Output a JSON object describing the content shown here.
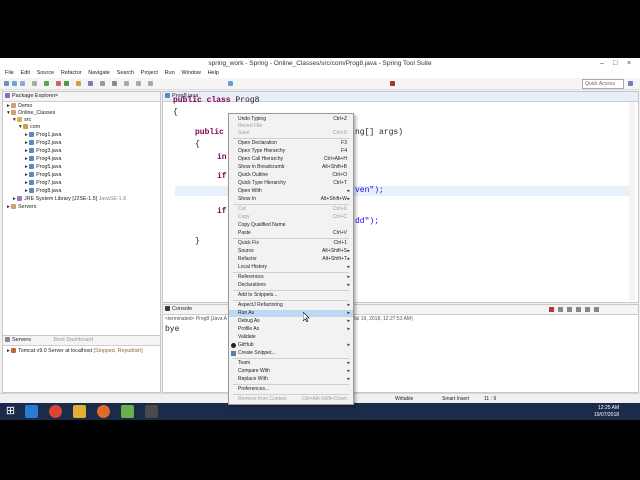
{
  "window": {
    "title": "spring_work - Spring - Online_Classes/src/com/Prog8.java - Spring Tool Suite"
  },
  "menubar": [
    "File",
    "Edit",
    "Source",
    "Refactor",
    "Navigate",
    "Search",
    "Project",
    "Run",
    "Window",
    "Help"
  ],
  "quick_access": {
    "placeholder": "Quick Access"
  },
  "package_explorer": {
    "title": "Package Explorer",
    "items": [
      "Demo",
      "Online_Classes",
      "src",
      "com",
      "Prog1.java",
      "Prog2.java",
      "Prog3.java",
      "Prog4.java",
      "Prog5.java",
      "Prog6.java",
      "Prog7.java",
      "Prog8.java",
      "JRE System Library [J2SE-1.5]",
      "JavaSE-1.8",
      "Servers"
    ]
  },
  "servers_panel": {
    "tab_servers": "Servers",
    "tab_boot": "Boot Dashboard",
    "item": "Tomcat v9.0 Server at localhost",
    "item_status": "[Stopped, Republish]"
  },
  "editor": {
    "tab": "Prog8.java",
    "lines": {
      "l1_kw": "public class",
      "l1_rest": " Prog8",
      "l2": "{",
      "l3_kw": "public",
      "l3_right": "ng[] args)",
      "l4": "{",
      "l5": "in",
      "l6": "if",
      "l6_right": "ven\");",
      "l7": "if",
      "l7_right": "dd\");",
      "l8": "}"
    }
  },
  "console": {
    "title": "Console",
    "terminated": "<terminated> Prog8 [Java A",
    "date": "Jul 19, 2018, 12:27:53 AM)",
    "output": "bye"
  },
  "status": {
    "writable": "Writable",
    "insert": "Smart Insert",
    "position": "11 : 9"
  },
  "taskbar": {
    "time": "12:25 AM",
    "date": "19/07/2018"
  },
  "context_menu": {
    "items": [
      {
        "label": "Undo Typing",
        "shortcut": "Ctrl+Z"
      },
      {
        "label": "Revert File",
        "shortcut": "",
        "disabled": true
      },
      {
        "label": "Save",
        "shortcut": "Ctrl+S",
        "disabled": true
      },
      {
        "label": "Open Declaration",
        "shortcut": "F3"
      },
      {
        "label": "Open Type Hierarchy",
        "shortcut": "F4"
      },
      {
        "label": "Open Call Hierarchy",
        "shortcut": "Ctrl+Alt+H"
      },
      {
        "label": "Show in Breadcrumb",
        "shortcut": "Alt+Shift+B"
      },
      {
        "label": "Quick Outline",
        "shortcut": "Ctrl+O"
      },
      {
        "label": "Quick Type Hierarchy",
        "shortcut": "Ctrl+T"
      },
      {
        "label": "Open With",
        "shortcut": ""
      },
      {
        "label": "Show In",
        "shortcut": "Alt+Shift+W"
      },
      {
        "label": "Cut",
        "shortcut": "Ctrl+X",
        "disabled": true
      },
      {
        "label": "Copy",
        "shortcut": "Ctrl+C",
        "disabled": true
      },
      {
        "label": "Copy Qualified Name",
        "shortcut": ""
      },
      {
        "label": "Paste",
        "shortcut": "Ctrl+V"
      },
      {
        "label": "Quick Fix",
        "shortcut": "Ctrl+1"
      },
      {
        "label": "Source",
        "shortcut": "Alt+Shift+S"
      },
      {
        "label": "Refactor",
        "shortcut": "Alt+Shift+T"
      },
      {
        "label": "Local History",
        "shortcut": ""
      },
      {
        "label": "References",
        "shortcut": ""
      },
      {
        "label": "Declarations",
        "shortcut": ""
      },
      {
        "label": "Add to Snippets...",
        "shortcut": ""
      },
      {
        "label": "AspectJ Refactoring",
        "shortcut": ""
      },
      {
        "label": "Run As",
        "shortcut": ""
      },
      {
        "label": "Debug As",
        "shortcut": ""
      },
      {
        "label": "Profile As",
        "shortcut": ""
      },
      {
        "label": "Validate",
        "shortcut": ""
      },
      {
        "label": "GitHub",
        "shortcut": ""
      },
      {
        "label": "Create Snippet...",
        "shortcut": ""
      },
      {
        "label": "Team",
        "shortcut": ""
      },
      {
        "label": "Compare With",
        "shortcut": ""
      },
      {
        "label": "Replace With",
        "shortcut": ""
      },
      {
        "label": "Preferences...",
        "shortcut": ""
      },
      {
        "label": "Remove from Context",
        "shortcut": "Ctrl+Alt+Shift+Down",
        "disabled": true
      }
    ]
  }
}
